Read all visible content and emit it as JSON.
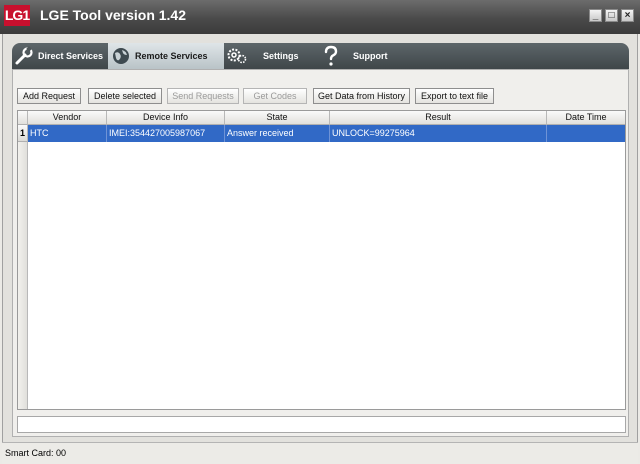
{
  "app": {
    "logo_text": "LG1",
    "title": "LGE Tool version 1.42",
    "logo_color": "#c8102e"
  },
  "window_controls": {
    "minimize": "_",
    "maximize": "□",
    "close": "×"
  },
  "tabs": [
    {
      "label": "Direct Services",
      "icon": "wrench-icon"
    },
    {
      "label": "Remote Services",
      "icon": "globe-icon",
      "active": true
    },
    {
      "label": "Settings",
      "icon": "gears-icon"
    },
    {
      "label": "Support",
      "icon": "question-icon"
    }
  ],
  "toolbar": {
    "add_request": "Add Request",
    "delete_selected": "Delete selected",
    "send_requests": "Send Requests",
    "get_codes": "Get Codes",
    "get_data_history": "Get Data from History",
    "export_text": "Export to text file"
  },
  "table": {
    "columns": [
      "Vendor",
      "Device Info",
      "State",
      "Result",
      "Date Time"
    ],
    "rows": [
      {
        "num": "1",
        "vendor": "HTC",
        "device_info": "IMEI:354427005987067",
        "state": "Answer received",
        "result": "UNLOCK=99275964",
        "date_time": ""
      }
    ],
    "selected_row_color": "#3169c6"
  },
  "status": {
    "smart_card": "Smart Card: 00"
  }
}
